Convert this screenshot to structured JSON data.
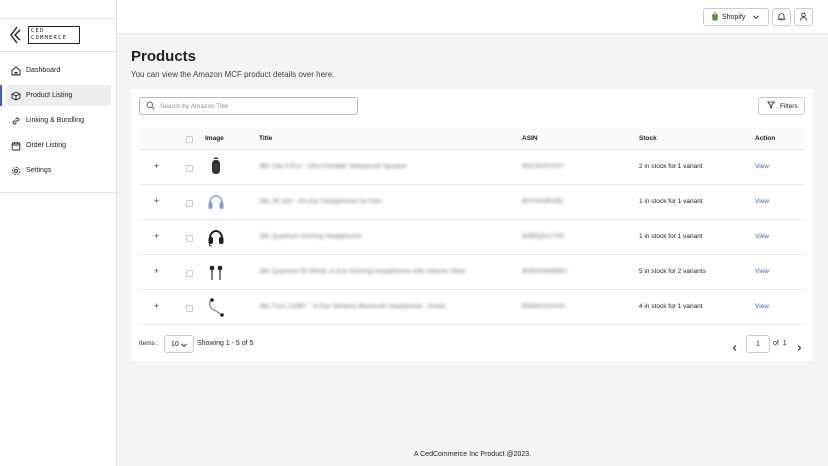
{
  "brand": {
    "logo_line1": "CED",
    "logo_line2": "COMMERCE"
  },
  "sidebar": {
    "items": [
      {
        "label": "Dashboard",
        "icon": "home-icon"
      },
      {
        "label": "Product Listing",
        "icon": "box-icon",
        "active": true
      },
      {
        "label": "Linking & Bundling",
        "icon": "link-icon"
      },
      {
        "label": "Order Listing",
        "icon": "calendar-icon"
      },
      {
        "label": "Settings",
        "icon": "gear-icon"
      }
    ]
  },
  "topbar": {
    "shop_label": "Shopify"
  },
  "page": {
    "title": "Products",
    "subtitle": "You can view the Amazon MCF product details over here."
  },
  "search": {
    "placeholder": "Search by Amazon Title"
  },
  "filters_label": "Filters",
  "table": {
    "headers": {
      "image": "Image",
      "title": "Title",
      "asin": "ASIN",
      "stock": "Stock",
      "action": "Action"
    },
    "rows": [
      {
        "title": "JBL Clip 4 Eco - Ultra-Portable Waterproof Speaker",
        "asin": "B0C3RXFSXY",
        "stock": "2 in stock for 1 variant",
        "action": "View"
      },
      {
        "title": "JBL JR 320 - On-Ear Headphones for Kids",
        "asin": "B07HH4BVB5",
        "stock": "1 in stock for 1 variant",
        "action": "View"
      },
      {
        "title": "JBL Quantum Gaming Headphones",
        "asin": "B0B5QH17XR",
        "stock": "1 in stock for 1 variant",
        "action": "View"
      },
      {
        "title": "JBL Quantum 50 Wired, In-Ear Gaming Headphones with Volume Slider",
        "asin": "B08WHM4MBV",
        "stock": "5 in stock for 2 variants",
        "action": "View"
      },
      {
        "title": "JBL Tune 225BT - In-Ear Wireless Bluetooth Headphone - Green",
        "asin": "B08KKHXHVH",
        "stock": "4 in stock for 1 variant",
        "action": "View"
      }
    ]
  },
  "pagination": {
    "items_label": "Items :",
    "per_page": "10",
    "showing": "Showing 1 - 5 of 5",
    "page": "1",
    "of": "of",
    "total_pages": "1"
  },
  "footer": "A CedCommerce Inc Product @2023.",
  "colors": {
    "accent": "#3b5bdb",
    "link": "#2c6ecb",
    "background": "#f4f4f4"
  }
}
